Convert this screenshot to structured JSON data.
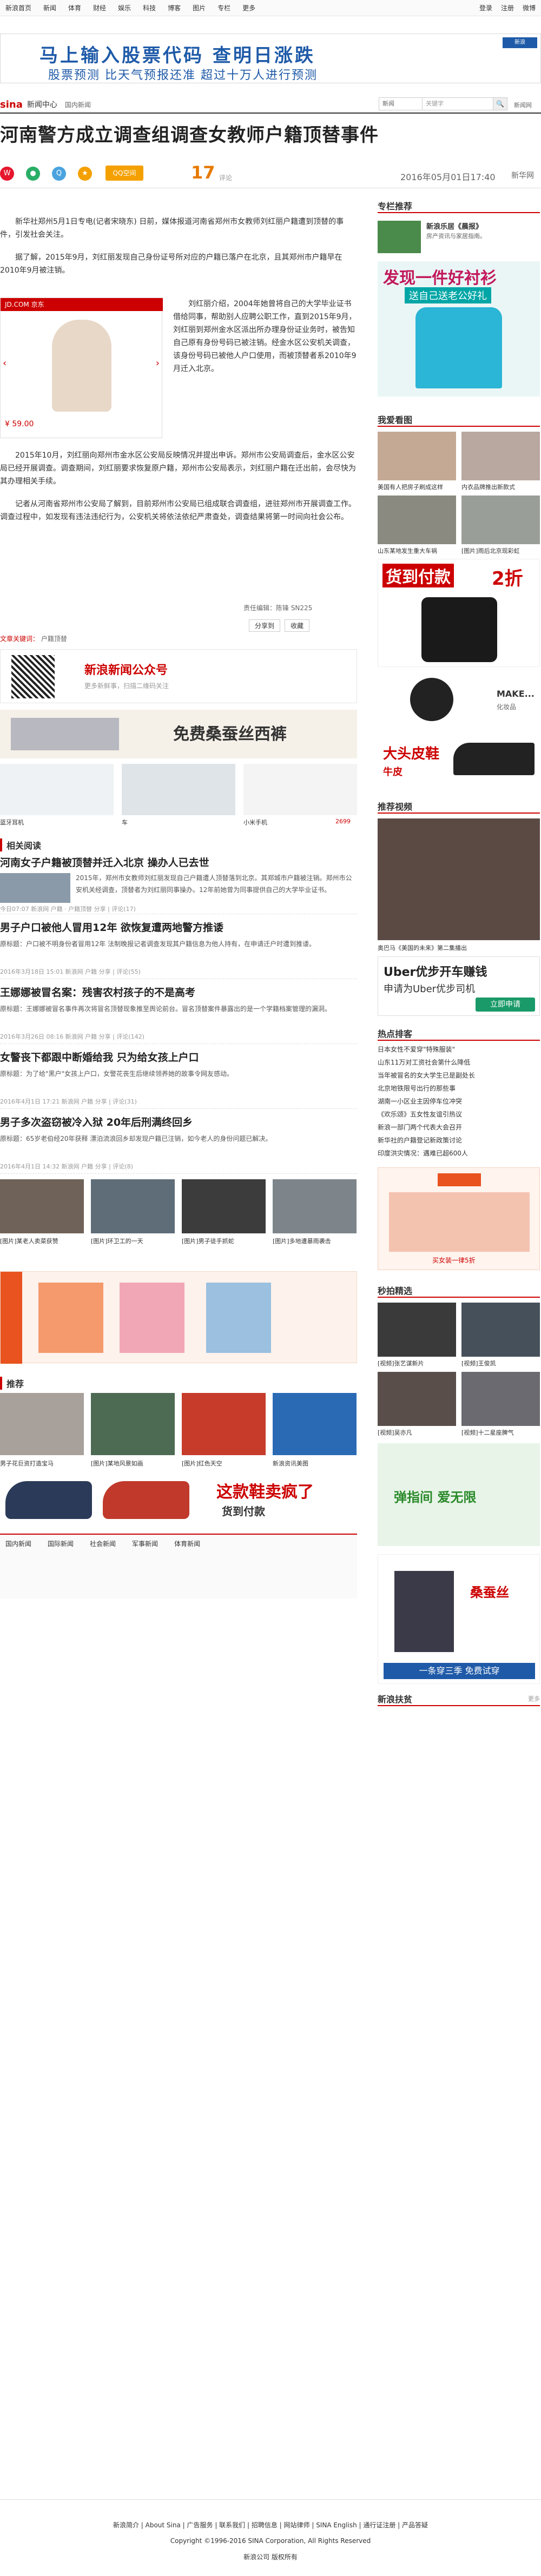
{
  "topnav": {
    "items": [
      "新浪首页",
      "新闻",
      "体育",
      "财经",
      "娱乐",
      "科技",
      "博客",
      "图片",
      "专栏",
      "更多"
    ],
    "right": [
      "登录",
      "注册",
      "微博"
    ]
  },
  "banner": {
    "headline": "马上输入股票代码 查明日涨跌",
    "sub": "股票预测 比天气预报还准 超过十万人进行预测",
    "logo": "新浪"
  },
  "channel": {
    "brand": "sina",
    "name": "新闻中心",
    "crumb": "国内新闻",
    "search_select": "新闻",
    "search_placeholder": "关键字",
    "links": "新闻网"
  },
  "article": {
    "title": "河南警方成立调查组调查女教师户籍顶替事件",
    "comments_count": "17",
    "comments_label": "评论",
    "qq_label": "QQ空间",
    "date": "2016年05月01日17:40",
    "source": "新华网",
    "paragraphs": [
      "新华社郑州5月1日专电(记者宋晓东) 日前，媒体报道河南省郑州市女教师刘红丽户籍遭到顶替的事件，引发社会关注。",
      "据了解，2015年9月，刘红丽发现自己身份证号所对应的户籍已落户在北京，且其郑州市户籍早在2010年9月被注销。",
      "刘红丽介绍，2004年她曾将自己的大学毕业证书借给同事，帮助别人应聘公职工作，直到2015年9月，刘红丽到郑州金水区派出所办理身份证业务时，被告知自己原有身份号码已被注销。经金水区公安机关调查，该身份号码已被他人户口使用，而被顶替者系2010年9月迁入北京。",
      "2015年10月，刘红丽向郑州市金水区公安局反映情况并提出申诉。郑州市公安局调查后，金水区公安局已经开展调查。调查期间，刘红丽要求恢复原户籍，郑州市公安局表示，刘红丽户籍在迁出前，会尽快为其办理相关手续。",
      "记者从河南省郑州市公安局了解到，目前郑州市公安局已组成联合调查组，进驻郑州市开展调查工作。调查过程中，如发现有违法违纪行为，公安机关将依法依纪严肃查处，调查结果将第一时间向社会公布。"
    ],
    "editor": "责任编辑：陈锋 SN225",
    "share_btn": "分享到",
    "fav_btn": "收藏",
    "tag_label": "文章关键词：",
    "tag": "户籍顶替"
  },
  "adlink": {
    "jdcom": "JD.COM 京东",
    "jdprice": "¥ 59.00",
    "wechat_title": "新浪新闻公众号",
    "wechat_sub": "更多新鲜事，扫描二维码关注"
  },
  "ads": {
    "cashmere": "免费桑蚕丝西裤",
    "item1_label": "蓝牙耳机",
    "item2_label": "车",
    "item3_label": "小米手机",
    "item3_price": "2699"
  },
  "related": {
    "heading": "相关阅读",
    "items": [
      {
        "title": "河南女子户籍被顶替并迁入北京 操办人已去世",
        "desc": "2015年，郑州市女教师刘红丽发现自己户籍遭人顶替落到北京。其郑城市户籍被注销。郑州市公安机关经调查，顶替者为刘红丽同事操办。12年前她曾为同事提供自己的大学毕业证书。",
        "meta": "今日07:07   新浪网   户籍 · 户籍顶替   分享 | 评论(17)"
      },
      {
        "title": "男子户口被他人冒用12年 欲恢复遭两地警方推诿",
        "desc": "原标题：户口被不明身份者冒用12年 法制晚报记者调查发现其户籍信息为他人持有，在申请迁户时遭到推诿。",
        "meta": "2016年3月18日 15:01   新浪网   户籍   分享 | 评论(55)"
      },
      {
        "title": "王娜娜被冒名案：残害农村孩子的不是高考",
        "desc": "原标题：王娜娜被冒名事件再次将冒名顶替现象推至舆论前台。冒名顶替案件暴露出的是一个学籍档案管理的漏洞。",
        "meta": "2016年3月26日 08:16   新浪网   户籍   分享 | 评论(142)"
      },
      {
        "title": "女警丧下都跟中断婚给我 只为给女孩上户口",
        "desc": "原标题：为了给\"黑户\"女孩上户口，女警花丧生后继续领养她的故事令网友感动。",
        "meta": "2016年4月1日 17:21   新浪网   户籍   分享 | 评论(31)"
      },
      {
        "title": "男子多次盗窃被冷入狱 20年后刑满终回乡",
        "desc": "原标题：65岁老伯经20年获释 漂泊流浪回乡却发现户籍已注销，如今老人的身份问题已解决。",
        "meta": "2016年4月1日 14:32   新浪网   户籍   分享 | 评论(8)"
      }
    ]
  },
  "photo_strip": [
    "[图片]某老人卖菜获赞",
    "[图片]环卫工的一天",
    "[图片]男子徒手抓蛇",
    "[图片]多地遭暴雨袭击"
  ],
  "recommend": {
    "heading": "推荐",
    "caps": [
      "男子花巨资打造宝马",
      "[图片]某地风景如画",
      "[图片]红色天空",
      "新浪资讯美图"
    ]
  },
  "sneakers_ad": "这款鞋卖疯了",
  "sneakers_sub": "货到付款",
  "bottom_tabs": [
    "国内新闻",
    "国际新闻",
    "社会新闻",
    "军事新闻",
    "体育新闻"
  ],
  "side": {
    "promo_head": "专栏推荐",
    "promo_title": "新浪乐居《晨报》",
    "promo_desc": "房产资讯与家居指南。",
    "tshirt_head": "发现一件好衬衫",
    "tshirt_sub": "送自己送老公好礼",
    "look_head": "我爱看图",
    "look_caps": [
      "美国有人把房子刷成这样",
      "内衣品牌推出新款式",
      "山东某地发生重大车祸",
      "[图片]雨后北京现彩虹",
      "新疆喀什古城风光",
      "[图片]古镇夜色"
    ],
    "bag_head": "货到付款",
    "bag_price": "2折",
    "makeup_title": "MAKE...",
    "makeup_sub": "化妆品",
    "shoes_title": "大头皮鞋",
    "shoes_sub": "牛皮",
    "video_head": "推荐视频",
    "video_cap": "奥巴马《美国的未来》第二集播出",
    "uber_title": "Uber优步开车赚钱",
    "uber_sub": "申请为Uber优步司机",
    "uber_btn": "立即申请",
    "hot_head": "热点排客",
    "hot_items": [
      "日本女性不爱穿\"特殊服装\"",
      "山东11万对工资社会第什么降低",
      "当年被冒名的女大学生已是副处长",
      "北京地铁限号出行的那些事",
      "湖南一小区业主因停车位冲突",
      "《欢乐颂》五女性友谊引热议",
      "新浪一部门两个代表大会召开",
      "新华社的户籍登记新政策讨论",
      "印度洪灾情况：遇难已超600人"
    ],
    "taobao_cap": "买女装一律5折",
    "stars_head": "秒拍精选",
    "stars_caps": [
      "[视频]张艺谋新片",
      "[视频]王俊凯",
      "[视频]吴亦凡",
      "[视频]十二星座脾气"
    ],
    "ad3_title": "弹指间 爱无限",
    "pants_title": "桑蚕丝",
    "pants_sub": "一条穿三季 免费试穿",
    "xinlang_head": "新浪扶贫",
    "xinlang_more": "更多"
  },
  "footer": {
    "links": "新浪简介 | About Sina | 广告服务 | 联系我们 | 招聘信息 | 网站律师 | SINA English | 通行证注册 | 产品答疑",
    "copy": "Copyright ©1996-2016 SINA Corporation, All Rights Reserved",
    "copy2": "新浪公司 版权所有"
  }
}
